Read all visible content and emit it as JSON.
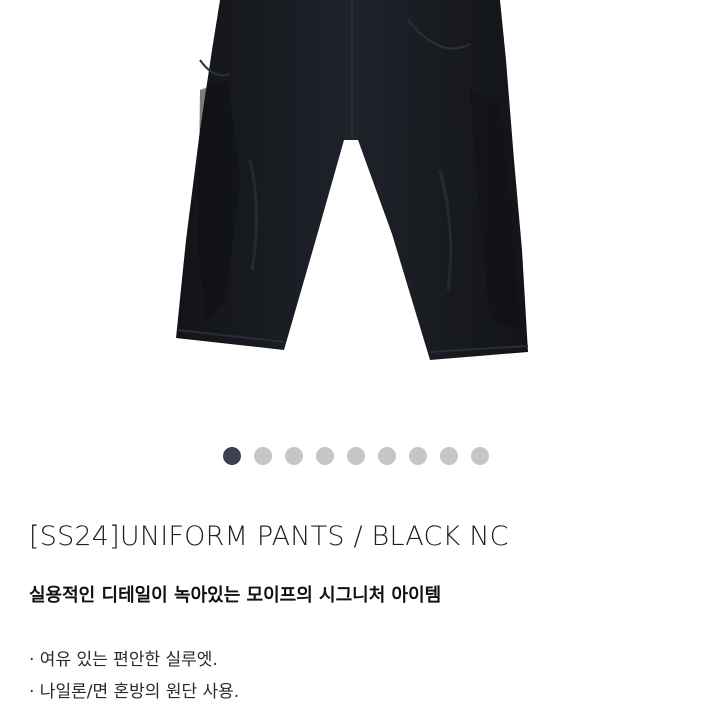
{
  "gallery": {
    "dots": [
      {
        "active": true
      },
      {
        "active": false
      },
      {
        "active": false
      },
      {
        "active": false
      },
      {
        "active": false
      },
      {
        "active": false
      },
      {
        "active": false
      },
      {
        "active": false
      },
      {
        "active": false
      }
    ],
    "active_color": "#3d4250",
    "inactive_color": "#c6c6c6"
  },
  "product": {
    "title": "[SS24]UNIFORM PANTS / BLACK NC",
    "subtitle": "실용적인 디테일이 녹아있는 모이프의 시그니처 아이템",
    "features": [
      "· 여유 있는 편안한 실루엣.",
      "· 나일론/면 혼방의 원단 사용."
    ]
  }
}
